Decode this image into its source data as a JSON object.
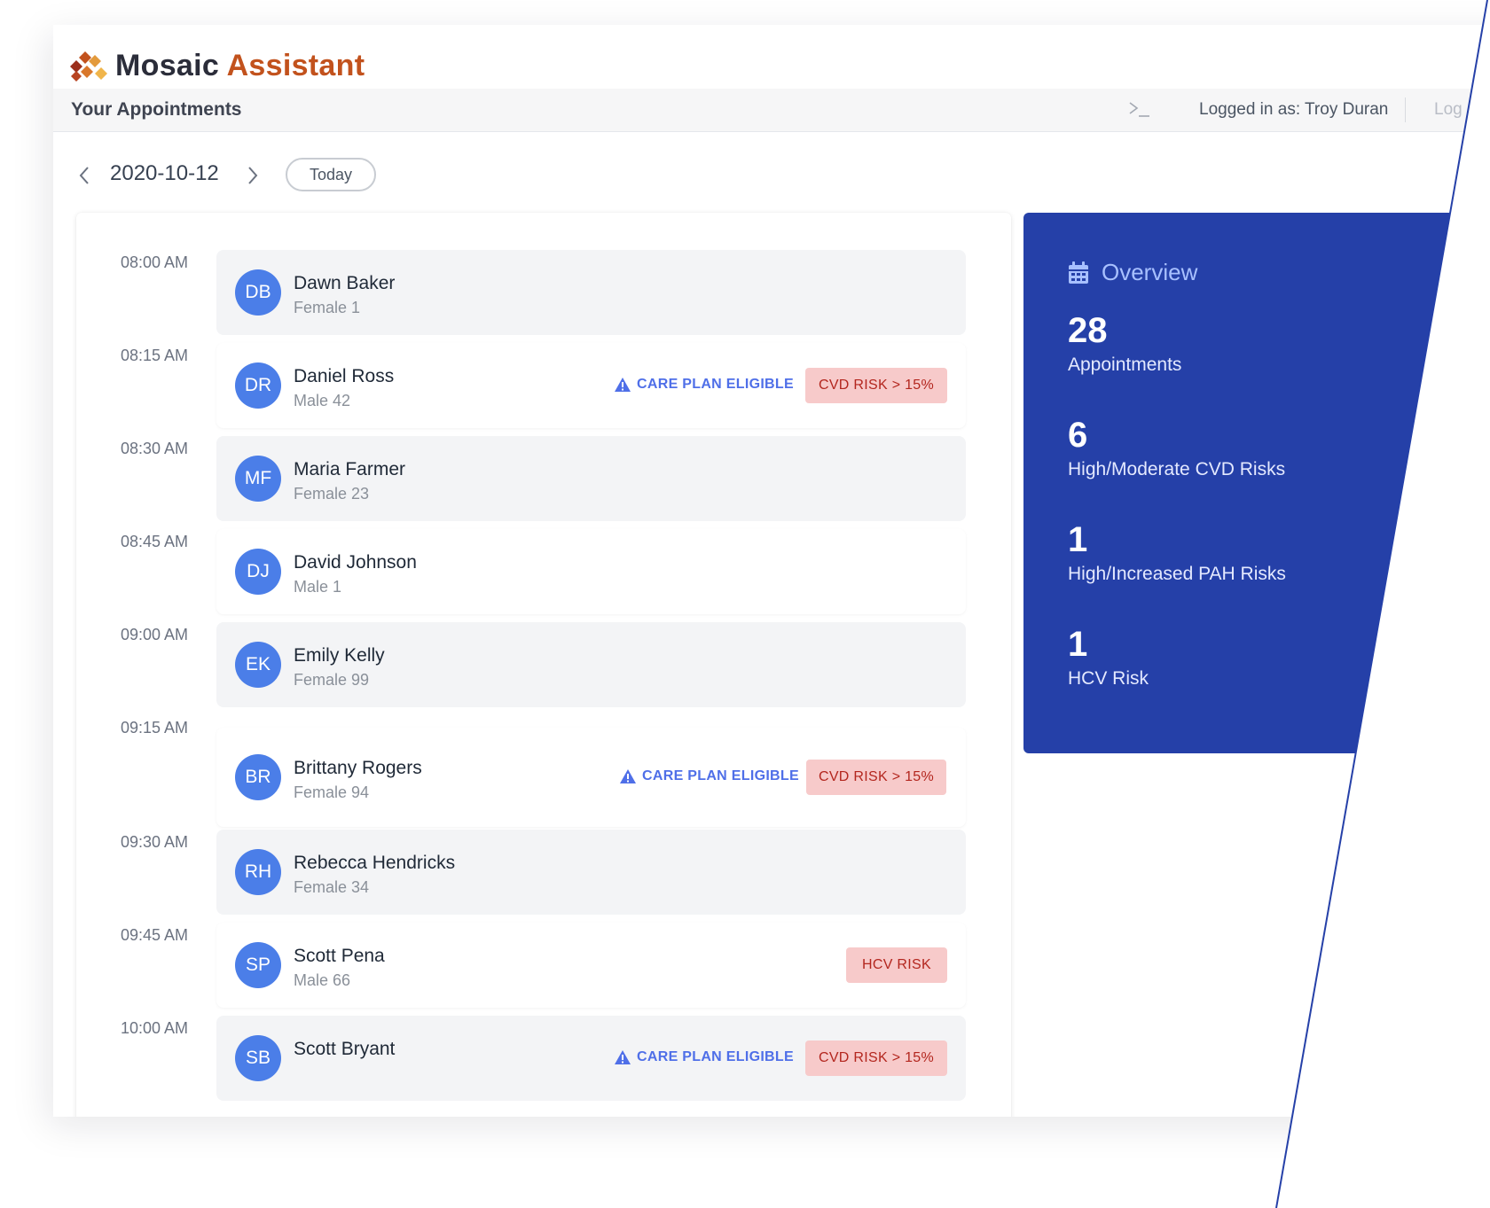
{
  "app": {
    "brand_first": "Mosaic",
    "brand_second": "Assistant",
    "brand_color_dark": "#2b2d3a",
    "brand_color_accent": "#c2521d"
  },
  "header": {
    "title": "Your Appointments",
    "terminal_icon": "terminal-icon",
    "logged_in": "Logged in as: Troy Duran",
    "logout": "Log"
  },
  "date_nav": {
    "date": "2020-10-12",
    "today_label": "Today",
    "prev_icon": "chevron-left-icon",
    "next_icon": "chevron-right-icon"
  },
  "appointments": [
    {
      "time": "08:00 AM",
      "initials": "DB",
      "name": "Dawn Baker",
      "meta": "Female 1",
      "care_plan": "",
      "risk": ""
    },
    {
      "time": "08:15 AM",
      "initials": "DR",
      "name": "Daniel Ross",
      "meta": "Male 42",
      "care_plan": "CARE PLAN ELIGIBLE",
      "risk": "CVD RISK > 15%"
    },
    {
      "time": "08:30 AM",
      "initials": "MF",
      "name": "Maria Farmer",
      "meta": "Female 23",
      "care_plan": "",
      "risk": ""
    },
    {
      "time": "08:45 AM",
      "initials": "DJ",
      "name": "David Johnson",
      "meta": "Male 1",
      "care_plan": "",
      "risk": ""
    },
    {
      "time": "09:00 AM",
      "initials": "EK",
      "name": "Emily Kelly",
      "meta": "Female 99",
      "care_plan": "",
      "risk": ""
    },
    {
      "time": "09:15 AM",
      "initials": "BR",
      "name": "Brittany Rogers",
      "meta": "Female 94",
      "care_plan": "CARE PLAN ELIGIBLE",
      "risk": "CVD RISK > 15%"
    },
    {
      "time": "09:30 AM",
      "initials": "RH",
      "name": "Rebecca Hendricks",
      "meta": "Female 34",
      "care_plan": "",
      "risk": ""
    },
    {
      "time": "09:45 AM",
      "initials": "SP",
      "name": "Scott Pena",
      "meta": "Male 66",
      "care_plan": "",
      "risk": "HCV RISK"
    },
    {
      "time": "10:00 AM",
      "initials": "SB",
      "name": "Scott Bryant",
      "meta": "",
      "care_plan": "CARE PLAN ELIGIBLE",
      "risk": "CVD RISK > 15%"
    }
  ],
  "overview": {
    "title": "Overview",
    "icon": "calendar-icon",
    "stats": [
      {
        "value": "28",
        "label": "Appointments"
      },
      {
        "value": "6",
        "label": "High/Moderate CVD Risks"
      },
      {
        "value": "1",
        "label": "High/Increased PAH Risks"
      },
      {
        "value": "1",
        "label": "HCV Risk"
      }
    ]
  },
  "colors": {
    "overview_bg": "#2540a8",
    "avatar": "#4b7ee8",
    "care_plan_text": "#4f6fe8",
    "risk_badge_bg": "#f7caca",
    "risk_badge_text": "#b3261e",
    "cut_line": "#2540a8"
  }
}
